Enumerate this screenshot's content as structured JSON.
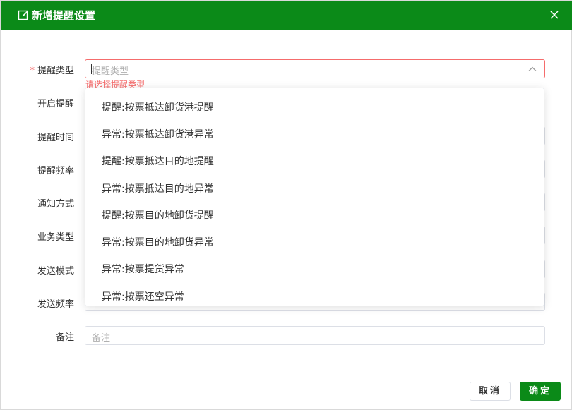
{
  "dialog": {
    "title": "新增提醒设置",
    "accent_color": "#0b8a18",
    "error_color": "#f56c6c"
  },
  "form": {
    "required_mark": "*",
    "reminder_type": {
      "label": "提醒类型",
      "placeholder": "提醒类型",
      "error": "请选择提醒类型"
    },
    "labels": {
      "enable_reminder": "开启提醒",
      "reminder_time": "提醒时间",
      "reminder_frequency": "提醒频率",
      "notify_method": "通知方式",
      "business_type": "业务类型",
      "send_mode": "发送模式",
      "send_frequency": "发送频率",
      "remark": "备注"
    },
    "remark_placeholder": "备注"
  },
  "dropdown": {
    "options": [
      "提醒:按票抵达卸货港提醒",
      "异常:按票抵达卸货港异常",
      "提醒:按票抵达目的地提醒",
      "异常:按票抵达目的地异常",
      "提醒:按票目的地卸货提醒",
      "异常:按票目的地卸货异常",
      "异常:按票提货异常",
      "异常:按票还空异常"
    ]
  },
  "footer": {
    "cancel_label": "取消",
    "ok_label": "确定"
  },
  "icons": {
    "header_left": "edit-icon",
    "header_right": "close-icon",
    "select_arrow": "chevron-up-icon"
  }
}
